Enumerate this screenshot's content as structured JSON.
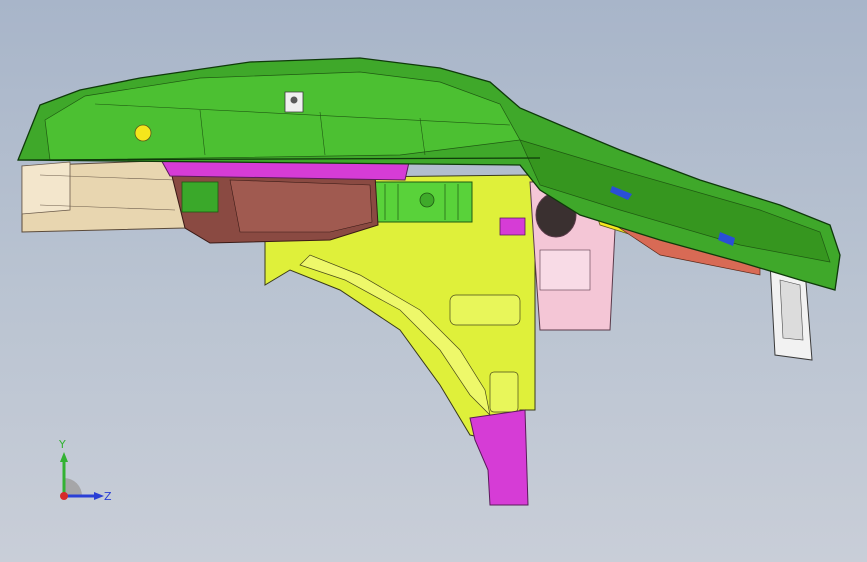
{
  "viewport": {
    "background_top": "#a8b5c9",
    "background_bottom": "#c9ced8"
  },
  "triad": {
    "y_label": "Y",
    "z_label": "Z",
    "y_color": "#33b233",
    "z_color": "#2a3fd6",
    "x_color": "#d62a2a"
  },
  "model": {
    "description_icon": "3d-assembly-icon",
    "part_colors": {
      "hood_green": "#3fa82a",
      "yellow_panel": "#e0f03c",
      "magenta_bracket": "#d63cd6",
      "brown_housing": "#8a4a42",
      "tan_rail": "#e8d6b0",
      "pink_panel": "#f4c6d6",
      "white_bracket": "#f2f2f2",
      "yellow_marker": "#f5e61c"
    }
  }
}
